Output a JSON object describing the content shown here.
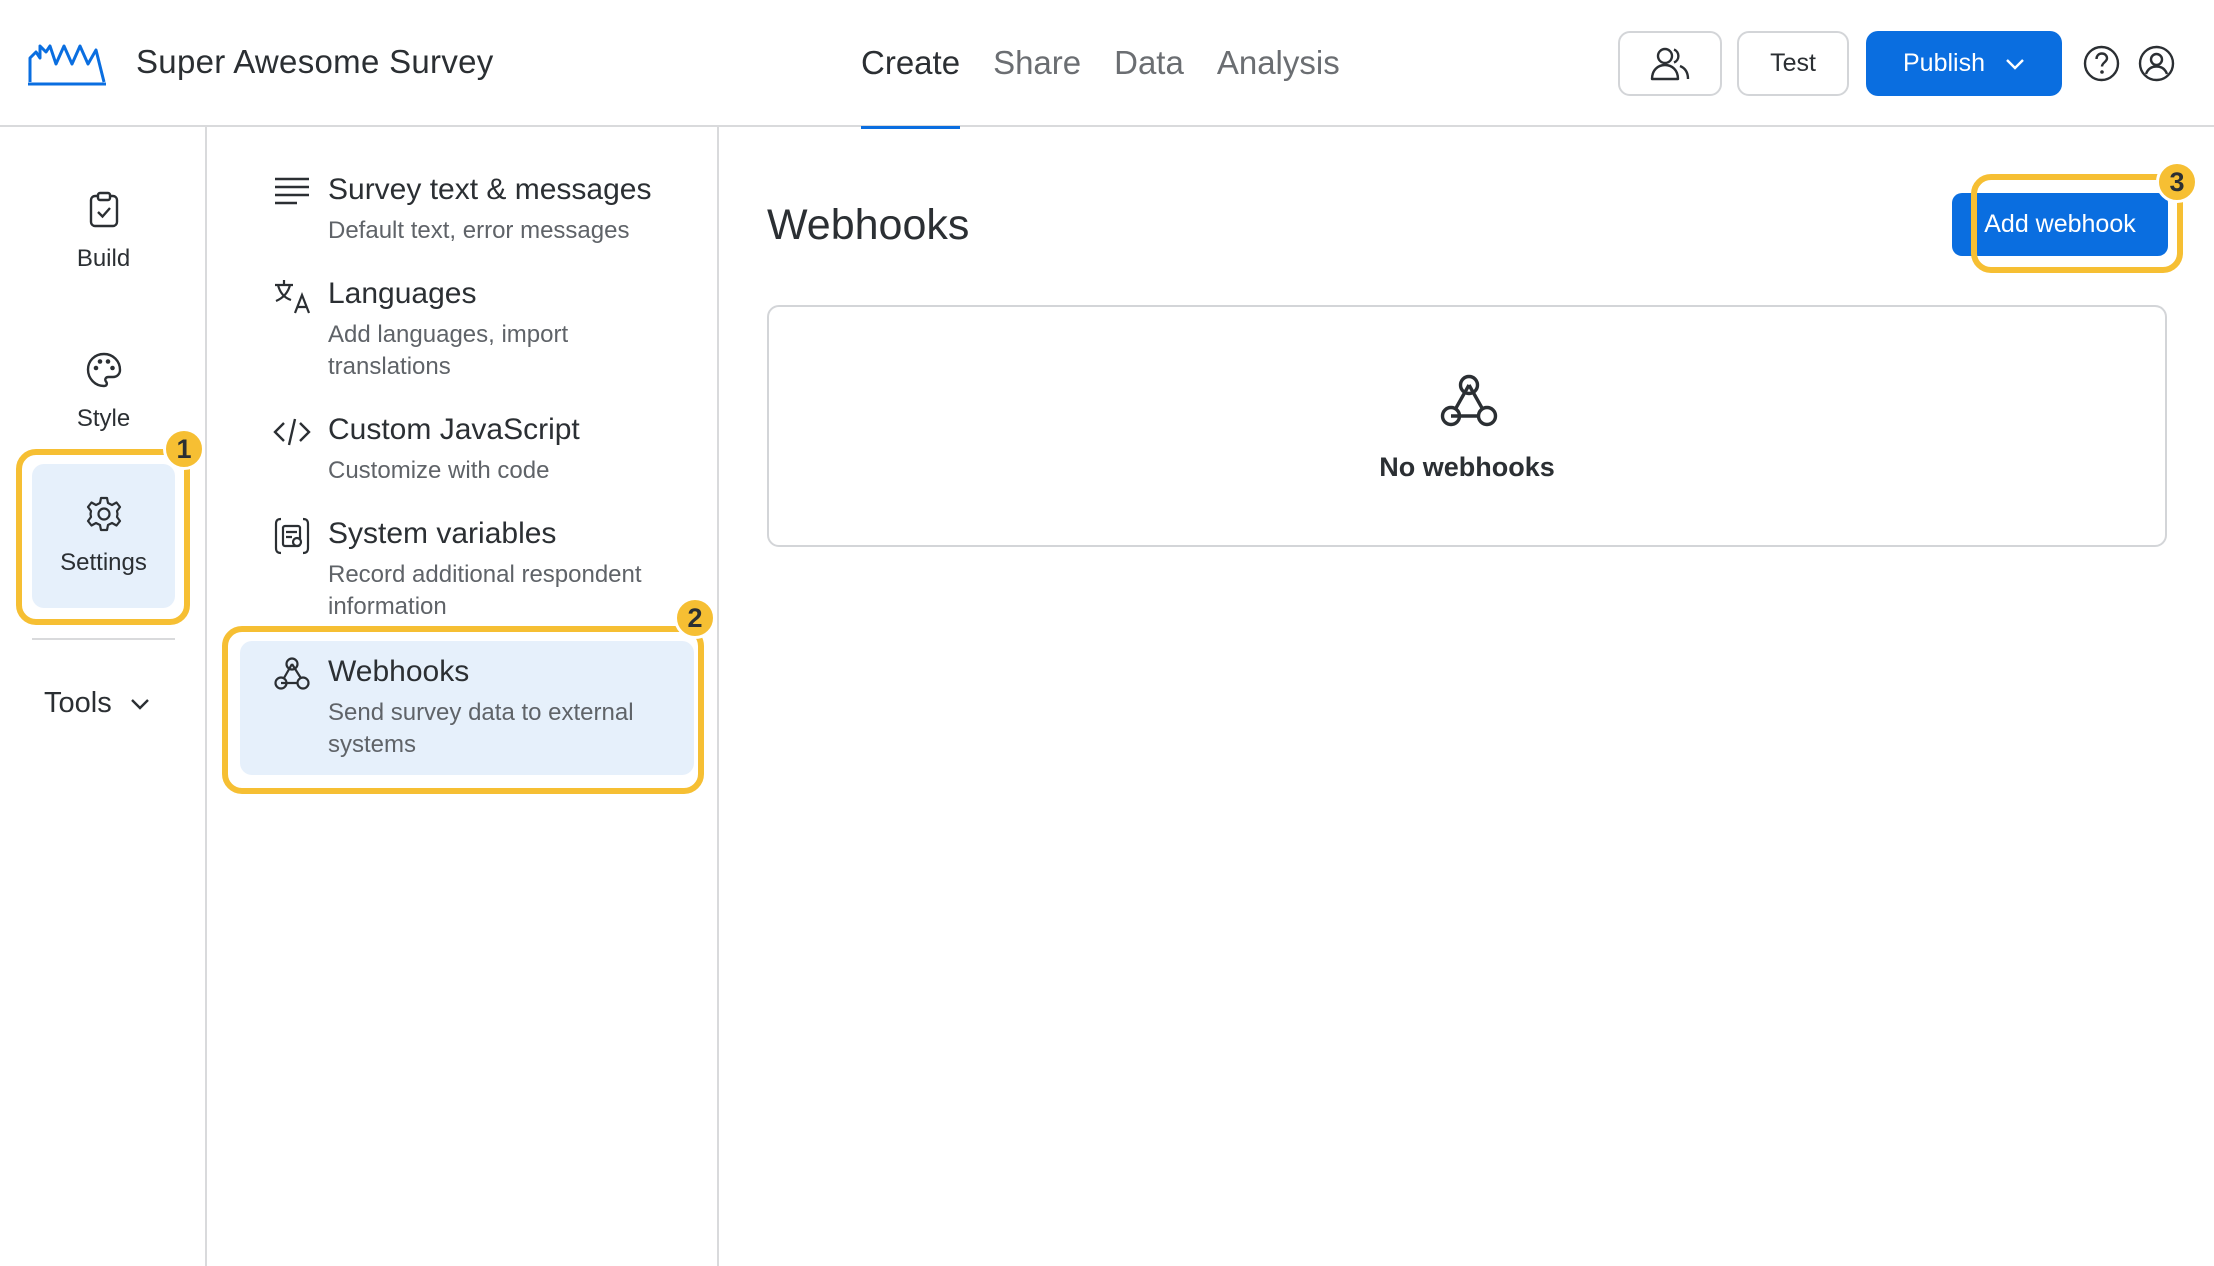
{
  "header": {
    "survey_title": "Super Awesome Survey",
    "tabs": [
      {
        "label": "Create",
        "active": true
      },
      {
        "label": "Share",
        "active": false
      },
      {
        "label": "Data",
        "active": false
      },
      {
        "label": "Analysis",
        "active": false
      }
    ],
    "test_label": "Test",
    "publish_label": "Publish",
    "icons": [
      "collaborators-icon",
      "help-icon",
      "user-account-icon",
      "chevron-down-icon"
    ]
  },
  "rail": {
    "items": [
      {
        "label": "Build",
        "icon": "clipboard-check-icon",
        "active": false
      },
      {
        "label": "Style",
        "icon": "palette-icon",
        "active": false
      },
      {
        "label": "Settings",
        "icon": "gear-icon",
        "active": true
      }
    ],
    "tools_label": "Tools"
  },
  "settings_menu": {
    "items": [
      {
        "title": "Survey text & messages",
        "desc": "Default text, error messages",
        "icon": "text-lines-icon",
        "active": false
      },
      {
        "title": "Languages",
        "desc": "Add languages, import translations",
        "icon": "translate-icon",
        "active": false
      },
      {
        "title": "Custom JavaScript",
        "desc": "Customize with code",
        "icon": "code-icon",
        "active": false
      },
      {
        "title": "System variables",
        "desc": "Record additional respondent information",
        "icon": "variables-icon",
        "active": false
      },
      {
        "title": "Webhooks",
        "desc": "Send survey data to external systems",
        "icon": "webhook-icon",
        "active": true
      }
    ]
  },
  "main": {
    "title": "Webhooks",
    "add_button_label": "Add webhook",
    "empty_state_text": "No webhooks"
  },
  "callouts": [
    {
      "number": "1"
    },
    {
      "number": "2"
    },
    {
      "number": "3"
    }
  ],
  "colors": {
    "accent": "#0a6ee0",
    "active_bg": "#e6f0fb",
    "callout": "#f6bf33",
    "text": "#2b2f33",
    "muted_text": "#5f6368",
    "border": "#d9dadc"
  }
}
